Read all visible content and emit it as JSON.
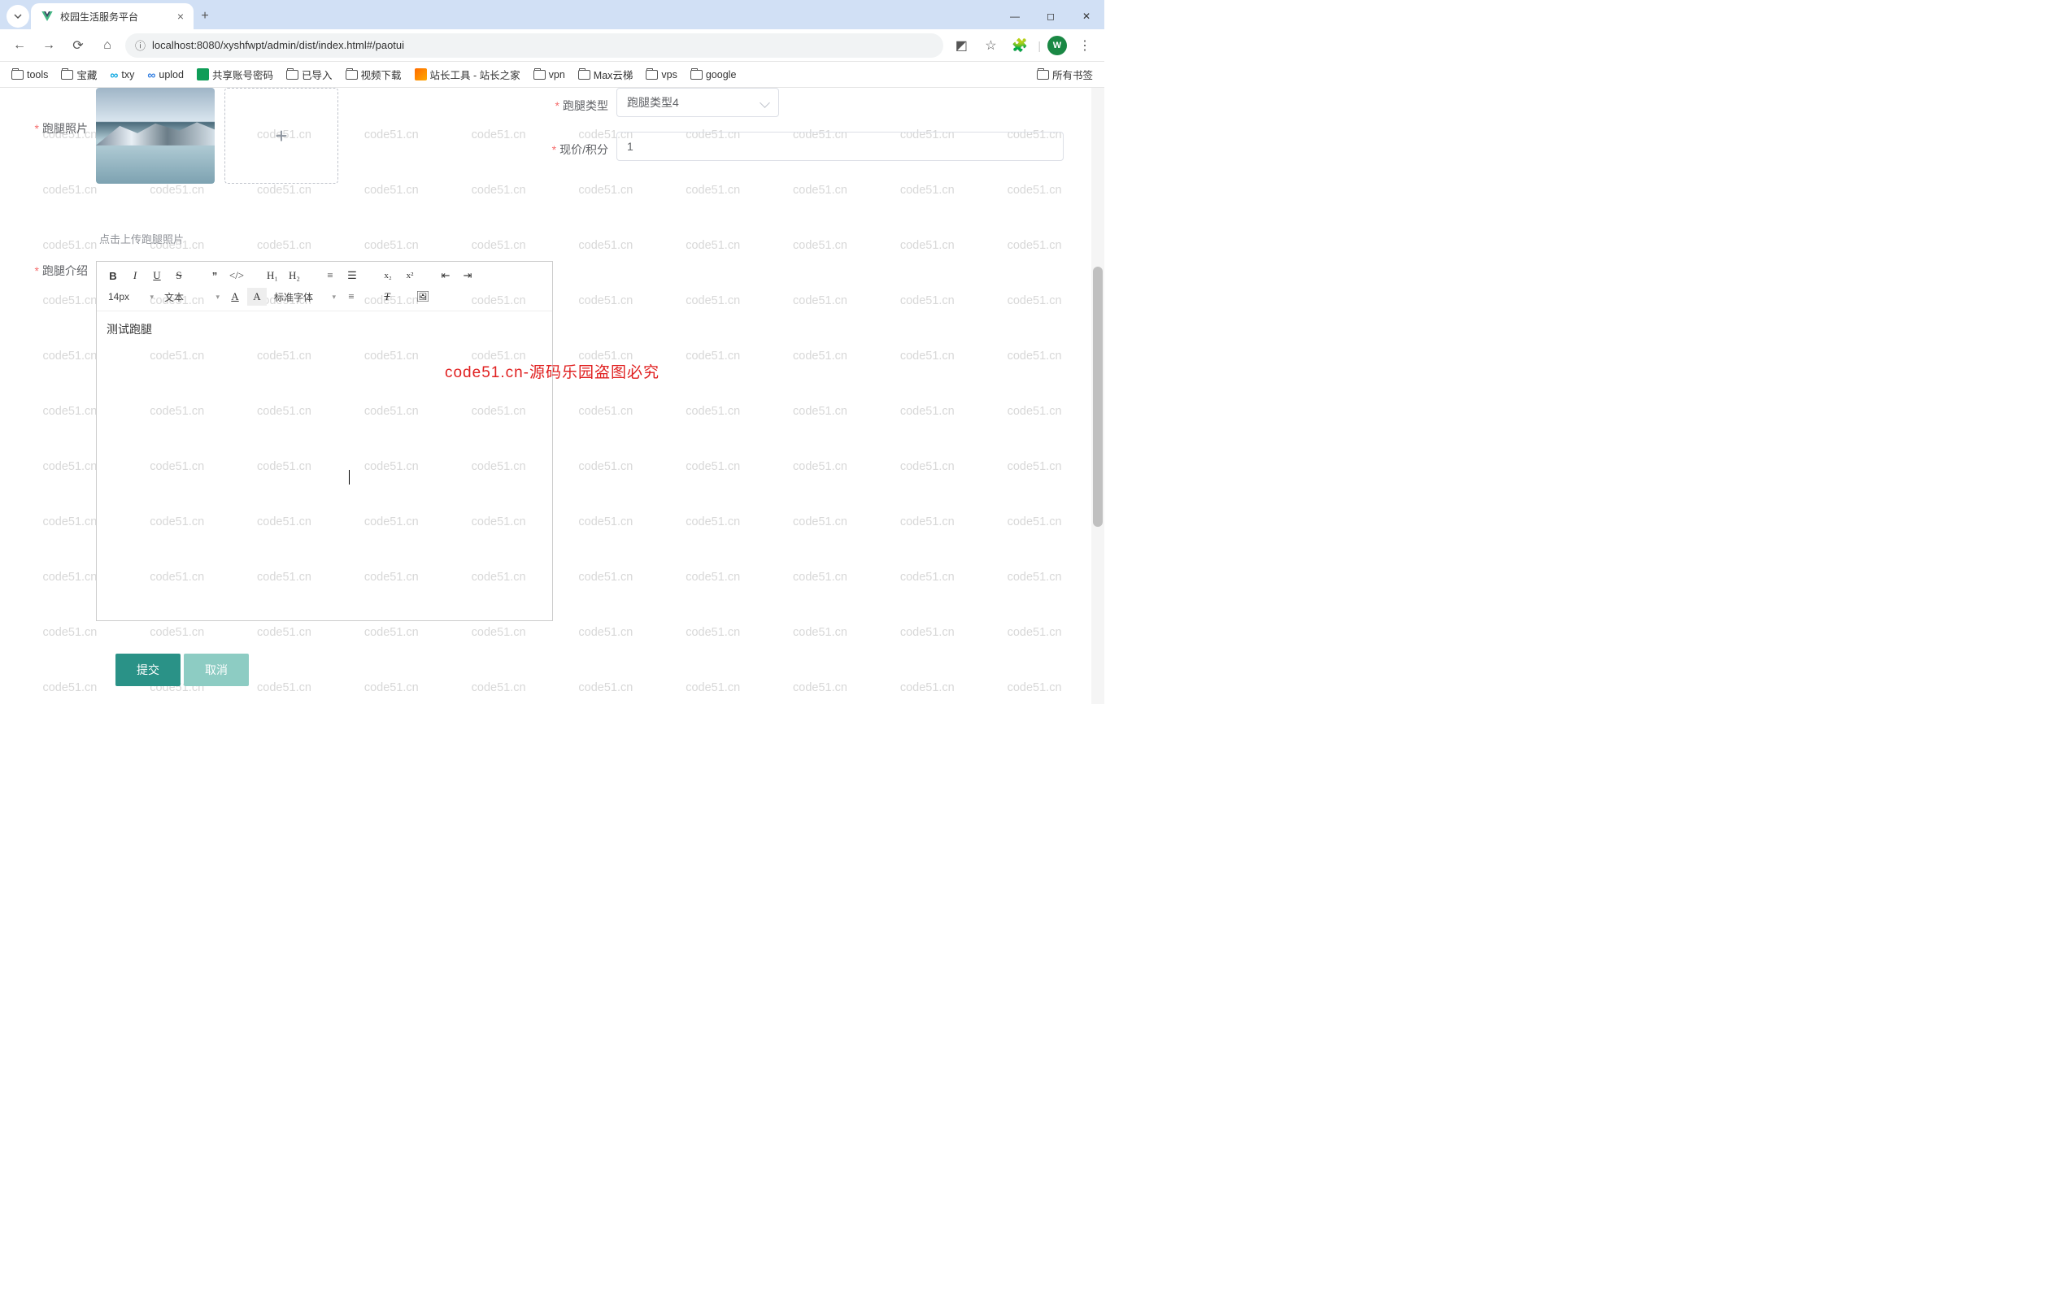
{
  "browser": {
    "tab_title": "校园生活服务平台",
    "url_scheme_icon": "ⓘ",
    "url": "localhost:8080/xyshfwpt/admin/dist/index.html#/paotui",
    "profile_letter": "W",
    "bookmarks": [
      {
        "label": "tools",
        "icon": "folder"
      },
      {
        "label": "宝藏",
        "icon": "folder"
      },
      {
        "label": "txy",
        "icon": "cloud"
      },
      {
        "label": "uplod",
        "icon": "cloud"
      },
      {
        "label": "共享账号密码",
        "icon": "green"
      },
      {
        "label": "已导入",
        "icon": "folder"
      },
      {
        "label": "视频下载",
        "icon": "folder"
      },
      {
        "label": "站长工具 - 站长之家",
        "icon": "orange"
      },
      {
        "label": "vpn",
        "icon": "folder"
      },
      {
        "label": "Max云梯",
        "icon": "folder"
      },
      {
        "label": "vps",
        "icon": "folder"
      },
      {
        "label": "google",
        "icon": "folder"
      }
    ],
    "all_bookmarks_label": "所有书签"
  },
  "form": {
    "photo_label": "跑腿照片",
    "upload_hint": "点击上传跑腿照片",
    "type_label": "跑腿类型",
    "type_value": "跑腿类型4",
    "price_label": "现价/积分",
    "price_value": "1",
    "intro_label": "跑腿介绍",
    "editor_content": "测试跑腿",
    "editor": {
      "font_size": "14px",
      "format": "文本",
      "font_family": "标准字体",
      "h1": "H₁",
      "h2": "H₂",
      "sub": "x₂",
      "sup": "x²"
    },
    "submit_label": "提交",
    "cancel_label": "取消"
  },
  "watermark": {
    "cell": "code51.cn",
    "banner": "code51.cn-源码乐园盗图必究"
  }
}
